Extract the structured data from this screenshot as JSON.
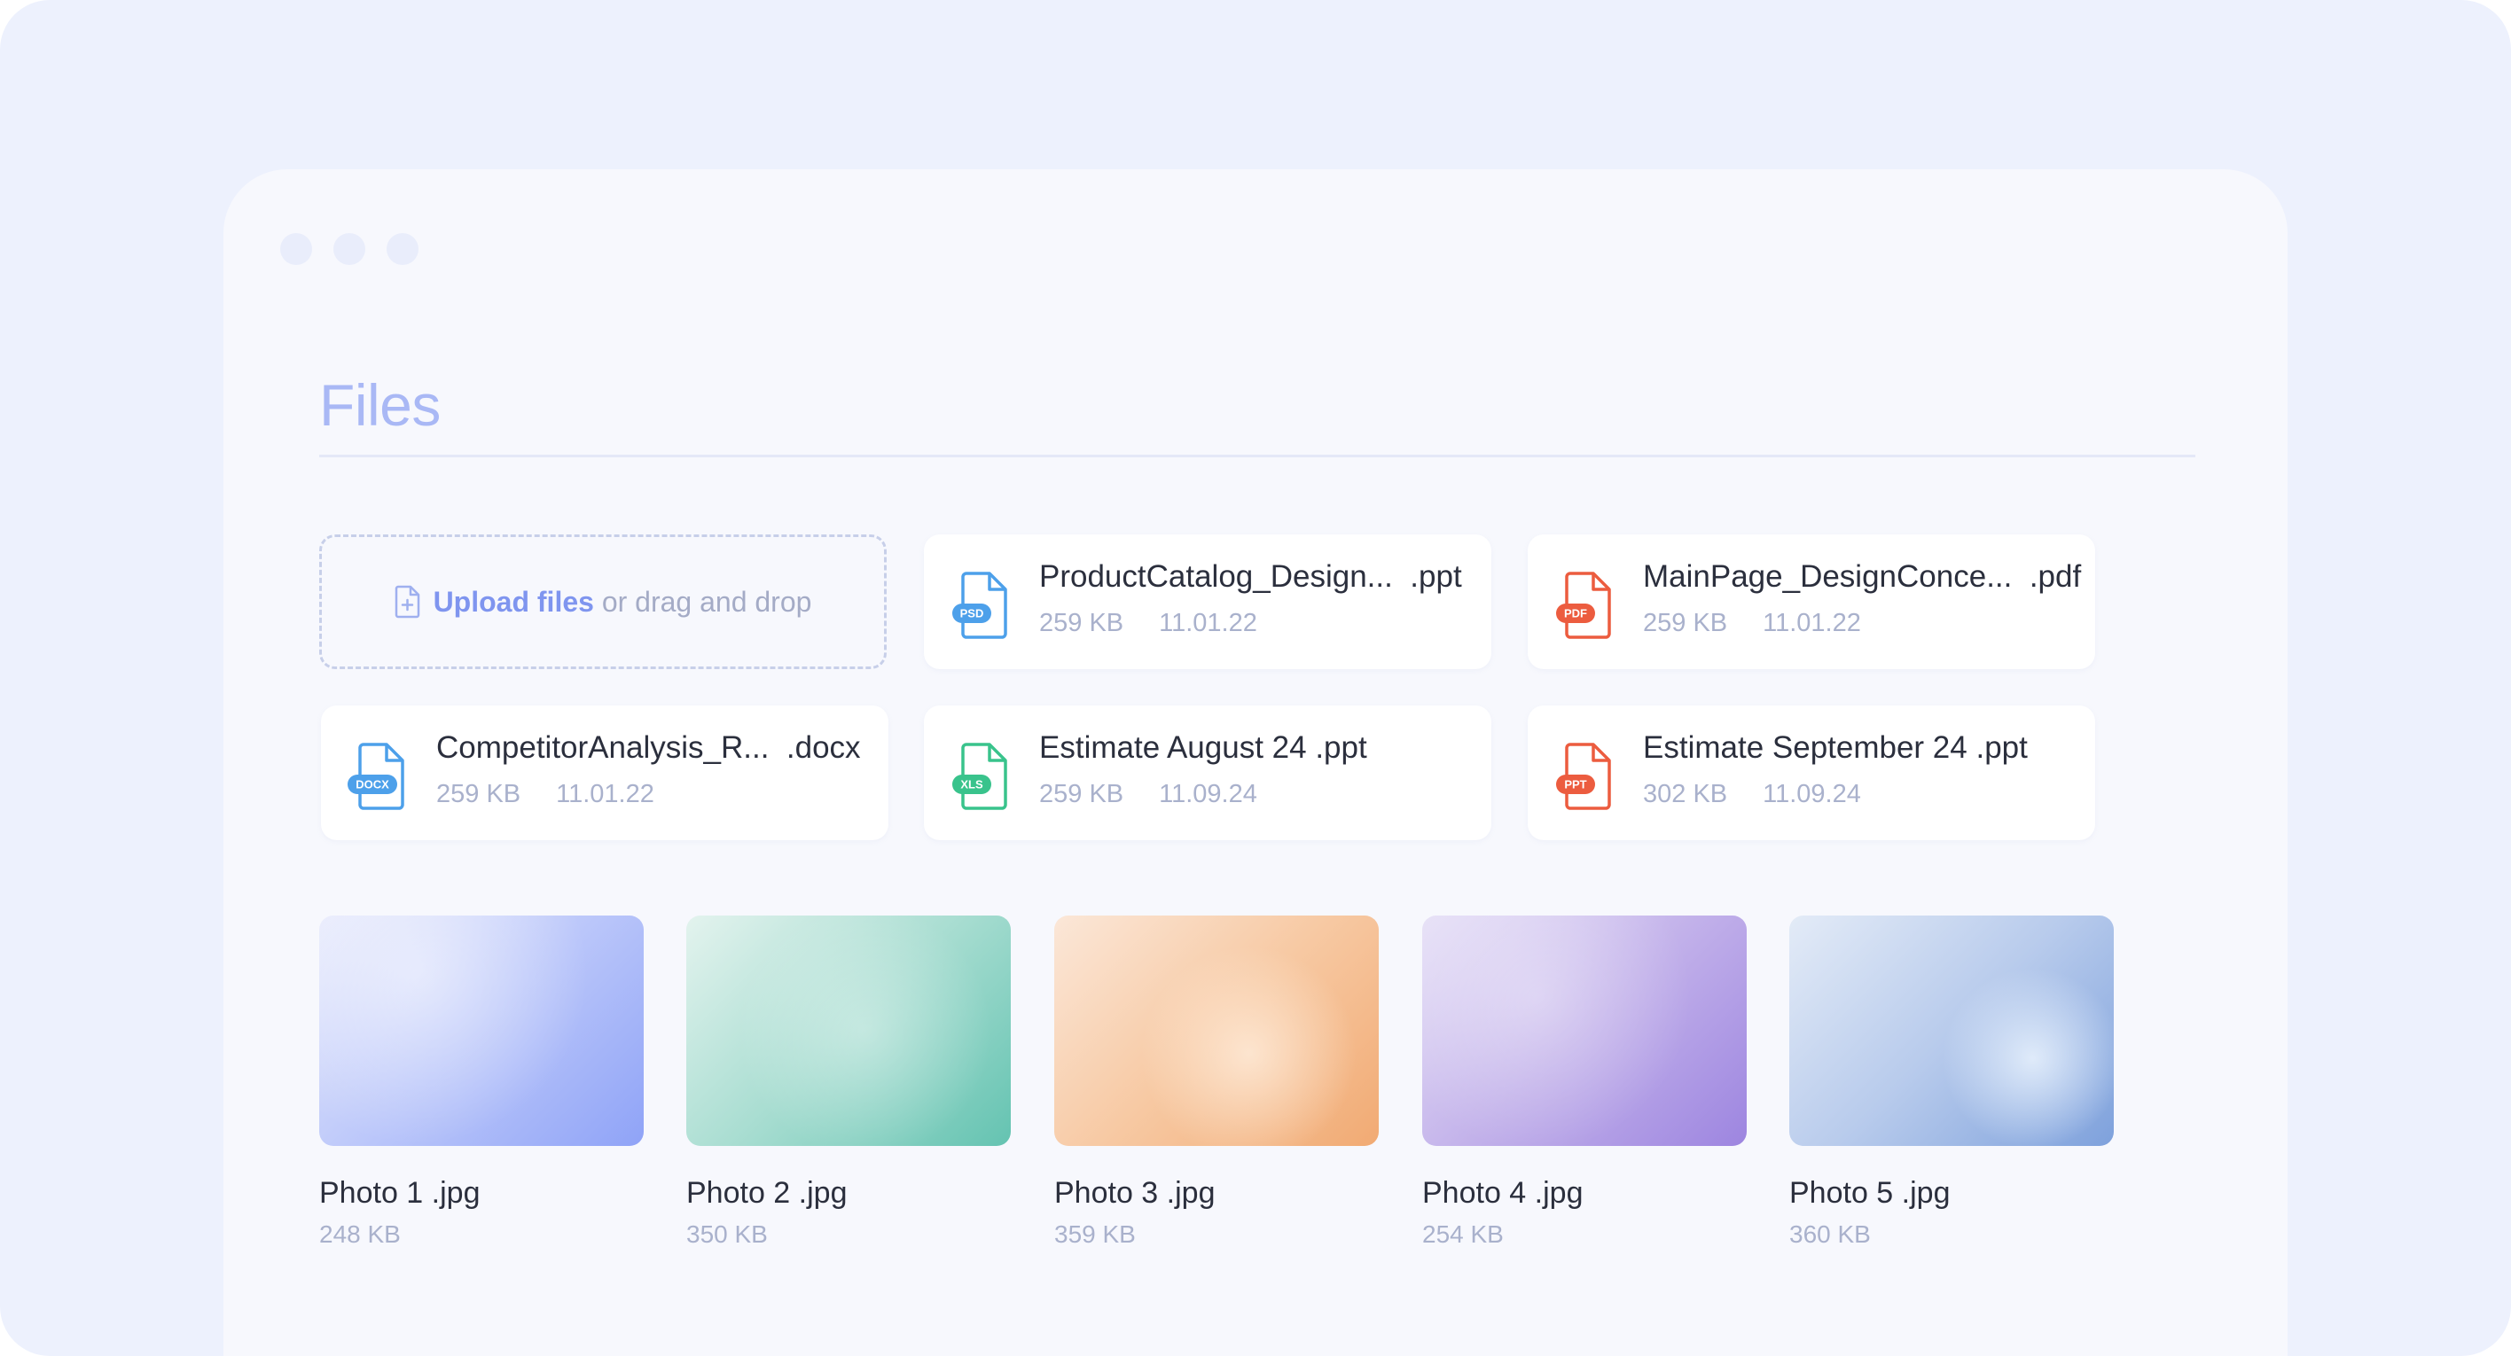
{
  "page": {
    "title": "Files"
  },
  "upload": {
    "link_label": "Upload files",
    "rest_label": " or drag and drop",
    "icon": "file-plus-icon"
  },
  "files": [
    {
      "name": "ProductCatalog_Design...",
      "ext": ".ppt",
      "badge": "PSD",
      "color": "#4da0ea",
      "size": "259 KB",
      "date": "11.01.22"
    },
    {
      "name": "MainPage_DesignConce...",
      "ext": ".pdf",
      "badge": "PDF",
      "color": "#ec5c3f",
      "size": "259 KB",
      "date": "11.01.22"
    },
    {
      "name": "CompetitorAnalysis_R...",
      "ext": ".docx",
      "badge": "DOCX",
      "color": "#4da0ea",
      "size": "259 KB",
      "date": "11.01.22"
    },
    {
      "name": "Estimate August 24",
      "ext": ".ppt",
      "badge": "XLS",
      "color": "#39c38c",
      "size": "259 KB",
      "date": "11.09.24"
    },
    {
      "name": "Estimate September 24",
      "ext": ".ppt",
      "badge": "PPT",
      "color": "#ec5c3f",
      "size": "302 KB",
      "date": "11.09.24"
    }
  ],
  "photos": [
    {
      "name": "Photo 1 .jpg",
      "size": "248 KB"
    },
    {
      "name": "Photo 2 .jpg",
      "size": "350 KB"
    },
    {
      "name": "Photo 3 .jpg",
      "size": "359 KB"
    },
    {
      "name": "Photo 4 .jpg",
      "size": "254 KB"
    },
    {
      "name": "Photo 5 .jpg",
      "size": "360 KB"
    }
  ]
}
